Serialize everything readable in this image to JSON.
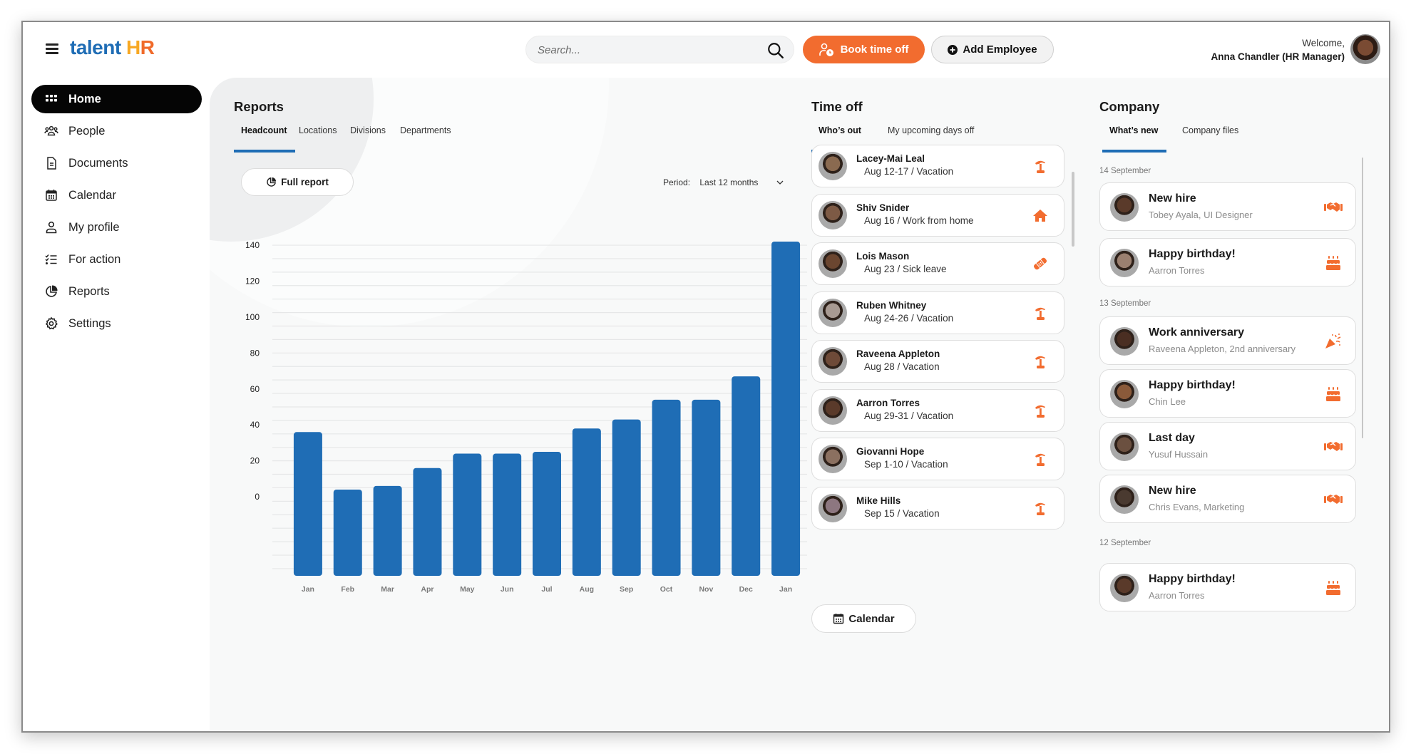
{
  "header": {
    "logo": {
      "part1": "talent ",
      "part2": "H",
      "part3": "R"
    },
    "search": {
      "placeholder": "Search..."
    },
    "book_time_off_label": "Book time off",
    "add_employee_label": "Add Employee",
    "welcome_label": "Welcome,",
    "user_name": "Anna Chandler (HR Manager)"
  },
  "sidebar": {
    "items": [
      {
        "label": "Home",
        "icon": "grid-icon",
        "active": true
      },
      {
        "label": "People",
        "icon": "people-icon"
      },
      {
        "label": "Documents",
        "icon": "document-icon"
      },
      {
        "label": "Calendar",
        "icon": "calendar-icon"
      },
      {
        "label": "My profile",
        "icon": "user-icon"
      },
      {
        "label": "For action",
        "icon": "checklist-icon"
      },
      {
        "label": "Reports",
        "icon": "pie-chart-icon"
      },
      {
        "label": "Settings",
        "icon": "gear-icon"
      }
    ]
  },
  "reports": {
    "title": "Reports",
    "tabs": [
      {
        "label": "Headcount",
        "active": true
      },
      {
        "label": "Locations"
      },
      {
        "label": "Divisions"
      },
      {
        "label": "Departments"
      }
    ],
    "full_report_label": "Full report",
    "period_label": "Period:",
    "period_value": "Last 12 months"
  },
  "chart_data": {
    "type": "bar",
    "title": "Headcount",
    "xlabel": "",
    "ylabel": "",
    "categories": [
      "Jan",
      "Feb",
      "Mar",
      "Apr",
      "May",
      "Jun",
      "Jul",
      "Aug",
      "Sep",
      "Oct",
      "Nov",
      "Dec",
      "Jan"
    ],
    "values": [
      36,
      4,
      6,
      16,
      24,
      24,
      25,
      38,
      43,
      54,
      54,
      67,
      142
    ],
    "yticks": [
      0,
      20,
      40,
      60,
      80,
      100,
      120,
      140
    ],
    "ylim": [
      -44,
      142
    ],
    "grid": true,
    "color": "#1f6db5"
  },
  "time_off": {
    "title": "Time off",
    "tabs": [
      {
        "label": "Who’s out",
        "active": true
      },
      {
        "label": "My upcoming days off"
      }
    ],
    "entries": [
      {
        "name": "Lacey-Mai Leal",
        "detail": "Aug 12-17 / Vacation",
        "type": "vacation",
        "avatar_color": "#8a6a50"
      },
      {
        "name": "Shiv Snider",
        "detail": "Aug 16 / Work from home",
        "type": "work-from-home",
        "avatar_color": "#7d5a45"
      },
      {
        "name": "Lois Mason",
        "detail": "Aug 23 / Sick leave",
        "type": "sick-leave",
        "avatar_color": "#6b4630"
      },
      {
        "name": "Ruben Whitney",
        "detail": "Aug 24-26 / Vacation",
        "type": "vacation",
        "avatar_color": "#a89a92"
      },
      {
        "name": "Raveena Appleton",
        "detail": "Aug 28 / Vacation",
        "type": "vacation",
        "avatar_color": "#6e4a38"
      },
      {
        "name": "Aarron Torres",
        "detail": "Aug 29-31 / Vacation",
        "type": "vacation",
        "avatar_color": "#5a3a2a"
      },
      {
        "name": "Giovanni Hope",
        "detail": "Sep 1-10 / Vacation",
        "type": "vacation",
        "avatar_color": "#8b7060"
      },
      {
        "name": "Mike Hills",
        "detail": "Sep 15 / Vacation",
        "type": "vacation",
        "avatar_color": "#8d7780"
      }
    ],
    "calendar_label": "Calendar"
  },
  "company": {
    "title": "Company",
    "tabs": [
      {
        "label": "What’s new",
        "active": true
      },
      {
        "label": "Company files"
      }
    ],
    "groups": [
      {
        "date": "14 September",
        "items": [
          {
            "title": "New hire",
            "subtitle": "Tobey Ayala, UI Designer",
            "icon": "handshake-icon",
            "avatar_color": "#5a3a2a"
          },
          {
            "title": "Happy birthday!",
            "subtitle": "Aarron Torres",
            "icon": "cake-icon",
            "avatar_color": "#9b8070"
          }
        ]
      },
      {
        "date": "13 September",
        "items": [
          {
            "title": "Work anniversary",
            "subtitle": "Raveena Appleton, 2nd anniversary",
            "icon": "party-popper-icon",
            "avatar_color": "#4a2e22"
          },
          {
            "title": "Happy birthday!",
            "subtitle": "Chin Lee",
            "icon": "cake-icon",
            "avatar_color": "#8a5a3a"
          },
          {
            "title": "Last day",
            "subtitle": "Yusuf Hussain",
            "icon": "handshake-icon",
            "avatar_color": "#6b5040"
          },
          {
            "title": "New hire",
            "subtitle": "Chris Evans, Marketing",
            "icon": "handshake-icon",
            "avatar_color": "#4a3a30"
          }
        ]
      },
      {
        "date": "12 September",
        "items": [
          {
            "title": "Happy birthday!",
            "subtitle": "Aarron Torres",
            "icon": "cake-icon",
            "avatar_color": "#5a3a2a"
          }
        ]
      }
    ]
  },
  "colors": {
    "brand_blue": "#1f6db5",
    "accent_orange": "#f26c2f"
  }
}
